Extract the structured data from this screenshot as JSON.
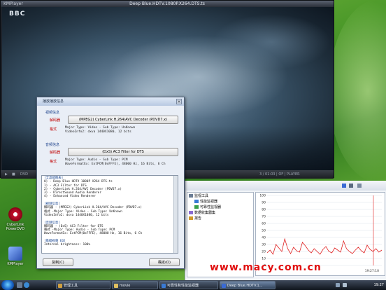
{
  "desktop": {
    "icons": [
      {
        "label": "CyberLink PowerDVD",
        "icon": "powerdvd-icon",
        "color": "#c8102e"
      },
      {
        "label": "KMPlayer",
        "icon": "kmplayer-icon",
        "color": "#3a6ad4"
      }
    ]
  },
  "player": {
    "app_name": "KMPlayer",
    "title": "Deep Blue.HDTV.1080P.X264.DTS.ts",
    "channel_logo": "BBC",
    "controls_text": "DVD",
    "controls_right": "3 / 01:03 | OF | PLAYER"
  },
  "dialog": {
    "title": "播放播放信息",
    "video_group": "视频信息",
    "decoder_label": "解码器",
    "video_decoder": "(MPEG2) CyberLink H.264/AVC Decoder (PDVD7.x)",
    "format_label": "格式",
    "video_format_lines": [
      "Major Type: Video - Sub Type: UnKnown",
      "VideoInfo2: dxva 1440X1080, 12 bits"
    ],
    "audio_group": "音频信息",
    "audio_decoder": "(DxS) AC3 Filter for DTS",
    "audio_format_lines": [
      "Major Type: Audio - Sub Type: PCM",
      "WaveFormatEx: ExtPCM(0xFFFE), 48000 Hz, 16 Bits, 6 Ch"
    ],
    "info_lines": [
      {
        "text": "[全滤镜图表]",
        "hd": true
      },
      {
        "text": "0) - Deep Blue HDTV 1080P X264 DTS.ts",
        "hd": false
      },
      {
        "text": "1) - AC3 Filter for DTS",
        "hd": false
      },
      {
        "text": "2) - CyberLink H.264/AVC Decoder (PDVD7.x)",
        "hd": false
      },
      {
        "text": "3) - DirectSound Audio Renderer",
        "hd": false
      },
      {
        "text": "4) - Enhanced Video Renderer",
        "hd": false
      },
      {
        "text": "",
        "hd": false
      },
      {
        "text": "[视频信息]",
        "hd": true
      },
      {
        "text": "解码器 - (MPEG2) CyberLink H.264/AVC Decoder (PDVD7.x)",
        "hd": false
      },
      {
        "text": "格式 -Major Type: Video - Sub Type: UnKnown",
        "hd": false
      },
      {
        "text": "VideoInfo2: dxva 1440X1080, 12 bits",
        "hd": false
      },
      {
        "text": "",
        "hd": false
      },
      {
        "text": "[音频信息]",
        "hd": true
      },
      {
        "text": "解码器 - (DxS) AC3 Filter for DTS",
        "hd": false
      },
      {
        "text": "格式 -Major Type: Audio - Sub Type: PCM",
        "hd": false
      },
      {
        "text": "WaveFormatEx: ExtPCM(0xFFFE), 48000 Hz, 16 Bits, 6 Ch",
        "hd": false
      },
      {
        "text": "",
        "hd": false
      },
      {
        "text": "[基础视频 EQ]",
        "hd": true
      },
      {
        "text": "Internal brightness: 100%",
        "hd": false
      }
    ],
    "copy_button": "复制(C)",
    "ok_button": "确定(O)"
  },
  "perfmon": {
    "tree": [
      {
        "label": "监视工具",
        "icon": "tools-icon",
        "color": "#6b7d95"
      },
      {
        "label": "性能监视器",
        "icon": "chart-icon",
        "color": "#3a7bd5"
      },
      {
        "label": "可靠性监视器",
        "icon": "reliability-icon",
        "color": "#3aa04a"
      },
      {
        "label": "数据收集器集",
        "icon": "collector-icon",
        "color": "#8a6ad0"
      },
      {
        "label": "报告",
        "icon": "report-icon",
        "color": "#d09a2a"
      }
    ],
    "y_ticks": [
      "100",
      "90",
      "80",
      "70",
      "60",
      "50",
      "40",
      "30",
      "20",
      "10",
      "0"
    ],
    "time_label": "19:27:10",
    "cpu_series": [
      18,
      22,
      16,
      30,
      25,
      20,
      38,
      24,
      17,
      26,
      21,
      19,
      33,
      28,
      22,
      18,
      24,
      20,
      16,
      23,
      27,
      20,
      18,
      25,
      22,
      19,
      35,
      24,
      20,
      17,
      22,
      26,
      21,
      18,
      29,
      23,
      20,
      24,
      19,
      22
    ],
    "line_color": "#e02020"
  },
  "watermark": "www.macy.com.cn",
  "taskbar": {
    "tasks": [
      {
        "label": "管理工具",
        "color": "#d0a040",
        "active": false
      },
      {
        "label": "movie",
        "color": "#e0c060",
        "active": false
      },
      {
        "label": "可靠性和性能监视器",
        "color": "#3a7bd5",
        "active": false
      },
      {
        "label": "Deep Blue.HDTV.1...",
        "color": "#3a6ad4",
        "active": true
      }
    ],
    "clock": "19:27"
  }
}
